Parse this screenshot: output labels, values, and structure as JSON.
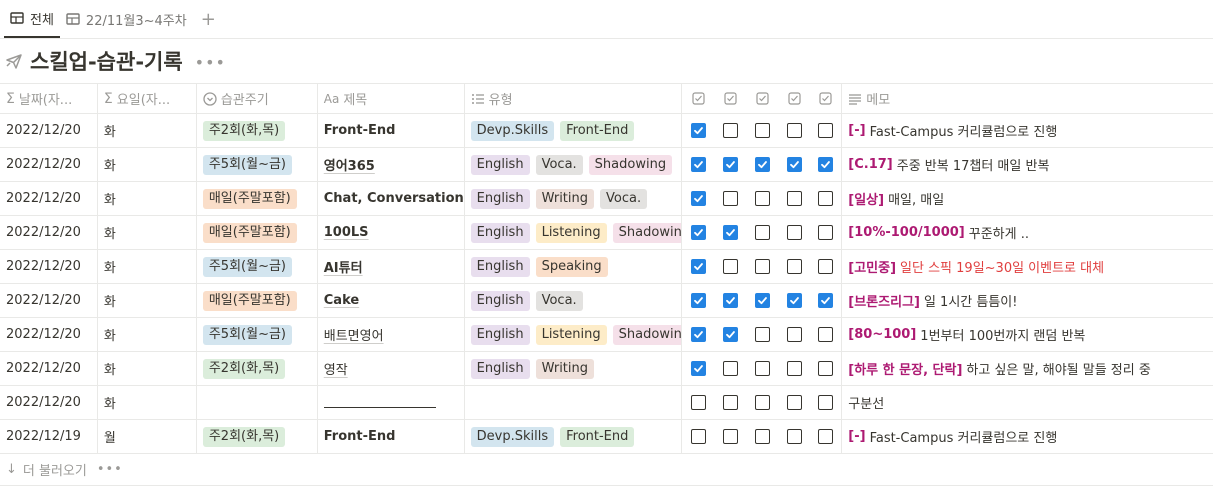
{
  "tabs": [
    {
      "label": "전체",
      "active": true
    },
    {
      "label": "22/11월3~4주차",
      "active": false
    }
  ],
  "tab_add": "+",
  "title": "스킬업-습관-기록",
  "title_more": "•••",
  "headers": {
    "date": "날짜(자...",
    "weekday": "요일(자...",
    "cycle": "습관주기",
    "name": "제목",
    "type": "유형",
    "memo": "메모"
  },
  "tag_colors": {
    "green": "#dbeddb",
    "blue": "#d3e5ef",
    "orange": "#fadec9",
    "purple": "#e8deee",
    "gray": "#e3e2e0",
    "pink": "#f5e0e9",
    "yellow": "#fdecc8",
    "brown": "#eee0da",
    "checkbox_blue": "#2383e2"
  },
  "rows": [
    {
      "date": "2022/12/20",
      "weekday": "화",
      "cycle": {
        "label": "주2회(화,목)",
        "color": "green"
      },
      "name": "Front-End",
      "name_style": "bold",
      "types": [
        {
          "label": "Devp.Skills",
          "color": "blue"
        },
        {
          "label": "Front-End",
          "color": "green"
        }
      ],
      "checks": [
        true,
        false,
        false,
        false,
        false
      ],
      "memo_tag": "[-]",
      "memo_text": "Fast-Campus 커리큘럼으로 진행",
      "memo_red": false
    },
    {
      "date": "2022/12/20",
      "weekday": "화",
      "cycle": {
        "label": "주5회(월~금)",
        "color": "blue"
      },
      "name": "영어365",
      "name_style": "bold-underline",
      "types": [
        {
          "label": "English",
          "color": "purple"
        },
        {
          "label": "Voca.",
          "color": "gray"
        },
        {
          "label": "Shadowing",
          "color": "pink"
        }
      ],
      "checks": [
        true,
        true,
        true,
        true,
        true
      ],
      "memo_tag": "[C.17]",
      "memo_text": "주중 반복 17챕터 매일 반복",
      "memo_red": false
    },
    {
      "date": "2022/12/20",
      "weekday": "화",
      "cycle": {
        "label": "매일(주말포함)",
        "color": "orange"
      },
      "name": "Chat, Conversation",
      "name_style": "bold",
      "types": [
        {
          "label": "English",
          "color": "purple"
        },
        {
          "label": "Writing",
          "color": "brown"
        },
        {
          "label": "Voca.",
          "color": "gray"
        }
      ],
      "checks": [
        true,
        false,
        false,
        false,
        false
      ],
      "memo_tag": "[일상]",
      "memo_text": "매일, 매일",
      "memo_red": false
    },
    {
      "date": "2022/12/20",
      "weekday": "화",
      "cycle": {
        "label": "매일(주말포함)",
        "color": "orange"
      },
      "name": "100LS",
      "name_style": "bold-underline",
      "types": [
        {
          "label": "English",
          "color": "purple"
        },
        {
          "label": "Listening",
          "color": "yellow"
        },
        {
          "label": "Shadowing",
          "color": "pink"
        }
      ],
      "checks": [
        true,
        true,
        false,
        false,
        false
      ],
      "memo_tag": "[10%-100/1000]",
      "memo_text": "꾸준하게 ..",
      "memo_red": false
    },
    {
      "date": "2022/12/20",
      "weekday": "화",
      "cycle": {
        "label": "주5회(월~금)",
        "color": "blue"
      },
      "name": "AI튜터",
      "name_style": "bold-underline",
      "types": [
        {
          "label": "English",
          "color": "purple"
        },
        {
          "label": "Speaking",
          "color": "orange"
        }
      ],
      "checks": [
        true,
        false,
        false,
        false,
        false
      ],
      "memo_tag": "[고민중]",
      "memo_text": "일단 스픽 19일~30일 이벤트로 대체",
      "memo_red": true
    },
    {
      "date": "2022/12/20",
      "weekday": "화",
      "cycle": {
        "label": "매일(주말포함)",
        "color": "orange"
      },
      "name": "Cake",
      "name_style": "bold-underline",
      "types": [
        {
          "label": "English",
          "color": "purple"
        },
        {
          "label": "Voca.",
          "color": "gray"
        }
      ],
      "checks": [
        true,
        true,
        true,
        true,
        true
      ],
      "memo_tag": "[브론즈리그]",
      "memo_text": "일 1시간 틈틈이!",
      "memo_red": false
    },
    {
      "date": "2022/12/20",
      "weekday": "화",
      "cycle": {
        "label": "주5회(월~금)",
        "color": "blue"
      },
      "name": "배트면영어",
      "name_style": "underline",
      "types": [
        {
          "label": "English",
          "color": "purple"
        },
        {
          "label": "Listening",
          "color": "yellow"
        },
        {
          "label": "Shadowing",
          "color": "pink"
        }
      ],
      "checks": [
        true,
        true,
        false,
        false,
        false
      ],
      "memo_tag": "[80~100]",
      "memo_text": "1번부터 100번까지 랜덤 반복",
      "memo_red": false
    },
    {
      "date": "2022/12/20",
      "weekday": "화",
      "cycle": {
        "label": "주2회(화,목)",
        "color": "green"
      },
      "name": "영작",
      "name_style": "underline",
      "types": [
        {
          "label": "English",
          "color": "purple"
        },
        {
          "label": "Writing",
          "color": "brown"
        }
      ],
      "checks": [
        true,
        false,
        false,
        false,
        false
      ],
      "memo_tag": "[하루 한 문장, 단락]",
      "memo_text": "하고 싶은 말, 해야될 말들 정리 중",
      "memo_red": false
    },
    {
      "date": "2022/12/20",
      "weekday": "화",
      "cycle": null,
      "name": "",
      "name_style": "divider",
      "types": [],
      "checks": [
        false,
        false,
        false,
        false,
        false
      ],
      "memo_tag": "",
      "memo_text": "구분선",
      "memo_red": false
    },
    {
      "date": "2022/12/19",
      "weekday": "월",
      "cycle": {
        "label": "주2회(화,목)",
        "color": "green"
      },
      "name": "Front-End",
      "name_style": "bold",
      "types": [
        {
          "label": "Devp.Skills",
          "color": "blue"
        },
        {
          "label": "Front-End",
          "color": "green"
        }
      ],
      "checks": [
        false,
        false,
        false,
        false,
        false
      ],
      "memo_tag": "[-]",
      "memo_text": "Fast-Campus 커리큘럼으로 진행",
      "memo_red": false
    }
  ],
  "footer": {
    "label": "더 불러오기",
    "more": "•••"
  }
}
